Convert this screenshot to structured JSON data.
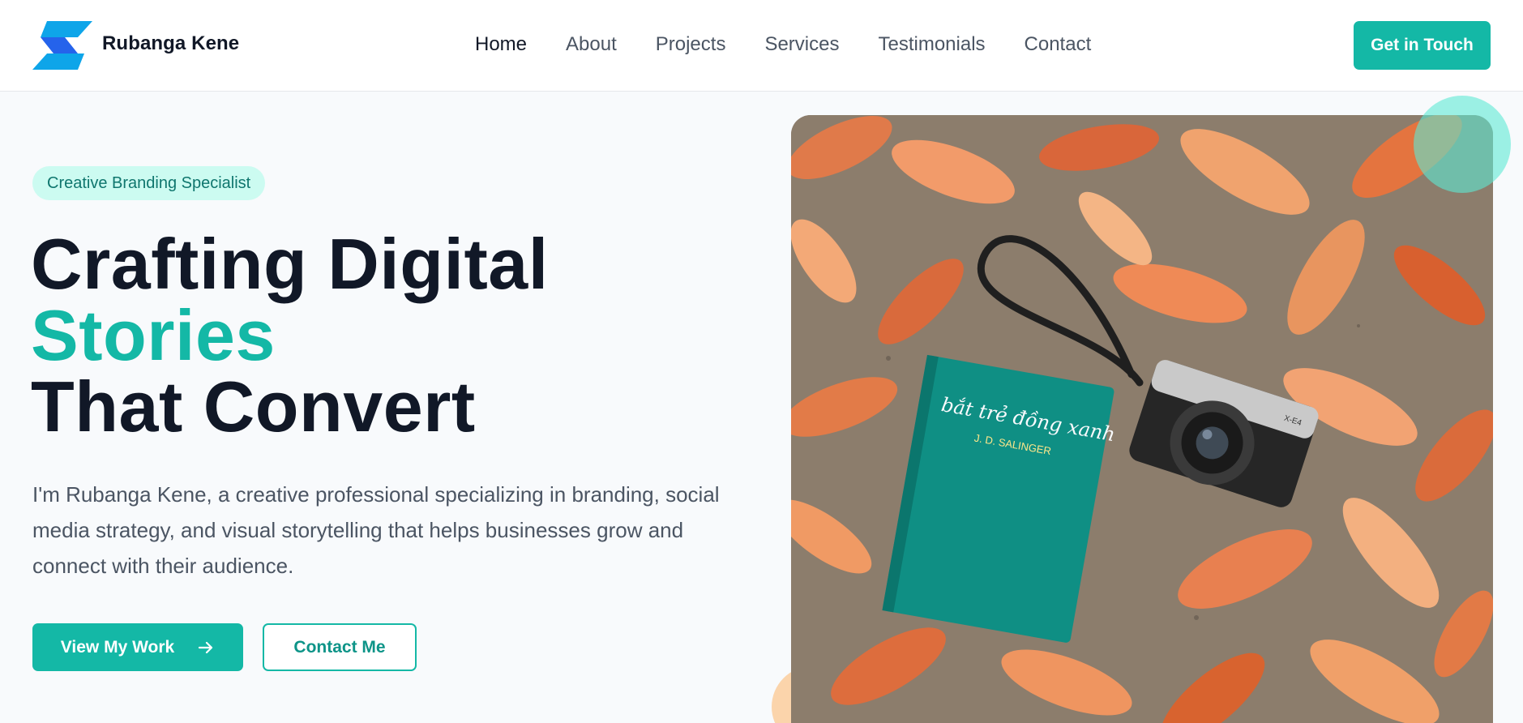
{
  "brand": {
    "name": "Rubanga Kene"
  },
  "nav": {
    "items": [
      {
        "label": "Home",
        "active": true
      },
      {
        "label": "About"
      },
      {
        "label": "Projects"
      },
      {
        "label": "Services"
      },
      {
        "label": "Testimonials"
      },
      {
        "label": "Contact"
      }
    ],
    "cta_label": "Get in Touch"
  },
  "hero": {
    "badge": "Creative Branding Specialist",
    "headline_line1": "Crafting Digital",
    "headline_line2": "Stories",
    "headline_line3": "That Convert",
    "description": "I'm Rubanga Kene, a creative professional specializing in branding, social media strategy, and visual storytelling that helps businesses grow and connect with their audience.",
    "primary_button": "View My Work",
    "secondary_button": "Contact Me",
    "image": {
      "book_title": "bắt trẻ đồng xanh",
      "book_author": "J. D. SALINGER",
      "camera_brand": "X-E4"
    }
  },
  "colors": {
    "accent": "#14b8a6",
    "accent_dark": "#0d9488",
    "badge_bg": "#ccfbf1",
    "heading": "#111827",
    "body_text": "#4b5563"
  },
  "icons": {
    "logo": "brand-logo-icon",
    "arrow": "arrow-right-icon"
  }
}
